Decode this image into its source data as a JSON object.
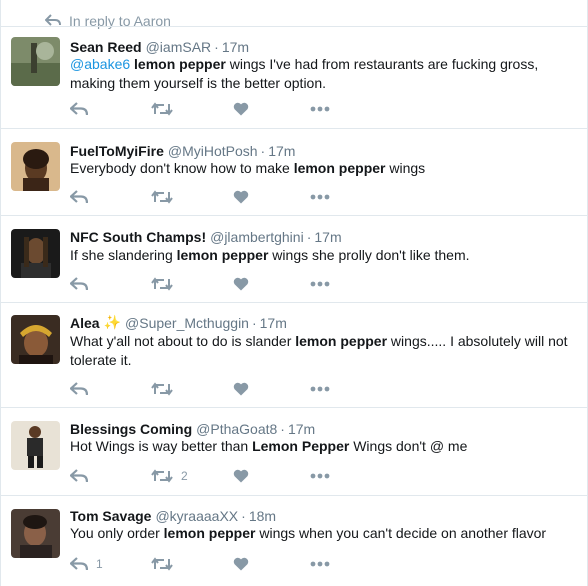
{
  "reply_context": {
    "label": "In reply to Aaron"
  },
  "tweets": [
    {
      "fullname": "Sean Reed",
      "screen_name": "@iamSAR",
      "time": "17m",
      "segments": [
        {
          "text": "@abake6",
          "style": "mention"
        },
        {
          "text": " ",
          "style": "plain"
        },
        {
          "text": "lemon pepper",
          "style": "bold"
        },
        {
          "text": " wings I've had from restaurants are fucking gross, making them yourself is the better option.",
          "style": "plain"
        }
      ],
      "reply_count": "",
      "retweet_count": "",
      "like_count": "",
      "avatar": "avatar-outdoor-scene"
    },
    {
      "fullname": "FuelToMyiFire",
      "screen_name": "@MyiHotPosh",
      "time": "17m",
      "segments": [
        {
          "text": "Everybody don't know how to make ",
          "style": "plain"
        },
        {
          "text": "lemon pepper",
          "style": "bold"
        },
        {
          "text": " wings",
          "style": "plain"
        }
      ],
      "reply_count": "",
      "retweet_count": "",
      "like_count": "",
      "avatar": "avatar-portrait"
    },
    {
      "fullname": "NFC South Champs!",
      "screen_name": "@jlambertghini",
      "time": "17m",
      "segments": [
        {
          "text": "If she slandering ",
          "style": "plain"
        },
        {
          "text": "lemon pepper",
          "style": "bold"
        },
        {
          "text": " wings she prolly don't like them.",
          "style": "plain"
        }
      ],
      "reply_count": "",
      "retweet_count": "",
      "like_count": "",
      "avatar": "avatar-portrait"
    },
    {
      "fullname": "Alea",
      "name_emoji": "✨",
      "screen_name": "@Super_Mcthuggin",
      "time": "17m",
      "segments": [
        {
          "text": "What y'all not about to do is slander ",
          "style": "plain"
        },
        {
          "text": "lemon pepper",
          "style": "bold"
        },
        {
          "text": " wings..... I absolutely will not tolerate it.",
          "style": "plain"
        }
      ],
      "reply_count": "",
      "retweet_count": "",
      "like_count": "",
      "avatar": "avatar-portrait"
    },
    {
      "fullname": "Blessings Coming",
      "screen_name": "@PthaGoat8",
      "time": "17m",
      "segments": [
        {
          "text": "Hot Wings is way better than ",
          "style": "plain"
        },
        {
          "text": "Lemon Pepper",
          "style": "bold"
        },
        {
          "text": " Wings don't @ me",
          "style": "plain"
        }
      ],
      "reply_count": "",
      "retweet_count": "2",
      "like_count": "",
      "avatar": "avatar-full-body"
    },
    {
      "fullname": "Tom Savage",
      "screen_name": "@kyraaaaXX",
      "time": "18m",
      "segments": [
        {
          "text": "You only order ",
          "style": "plain"
        },
        {
          "text": "lemon pepper",
          "style": "bold"
        },
        {
          "text": " wings when you can't decide on another flavor",
          "style": "plain"
        }
      ],
      "reply_count": "1",
      "retweet_count": "",
      "like_count": "",
      "avatar": "avatar-portrait"
    }
  ],
  "icons": {
    "reply": "reply-icon",
    "retweet": "retweet-icon",
    "like": "heart-icon",
    "more": "more-icon"
  },
  "colors": {
    "action_gray": "#8899a6",
    "mention_blue": "#1b95e0",
    "border": "#e1e8ed"
  },
  "separator": "·"
}
